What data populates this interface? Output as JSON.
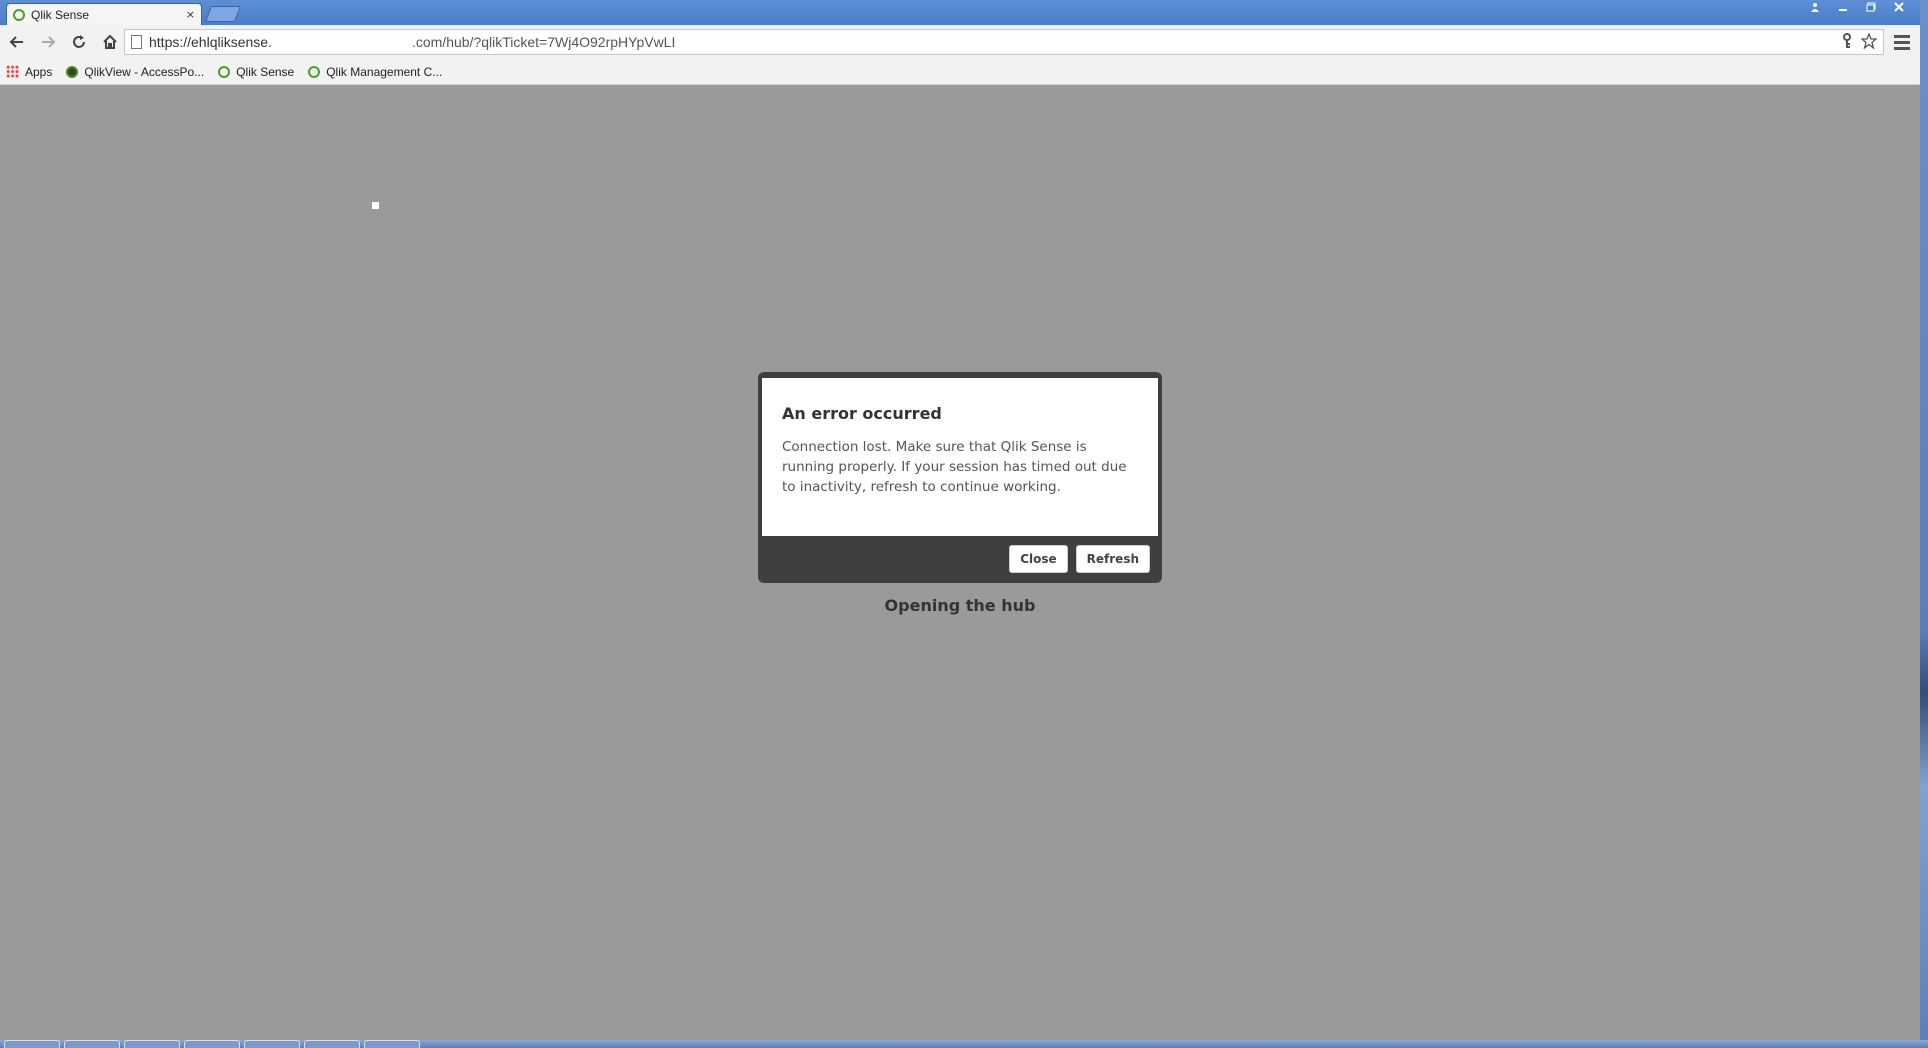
{
  "browser": {
    "tab_title": "Qlik Sense",
    "tab_close": "×",
    "url_part1": "https://ehlqliksense.",
    "url_part2": ".com/hub/?qlikTicket=7Wj4O92rpHYpVwLI",
    "window_controls": [
      "person-icon",
      "minimize-icon",
      "restore-icon",
      "close-icon"
    ]
  },
  "bookmarks": [
    {
      "label": "Apps",
      "icon": "apps-grid-icon"
    },
    {
      "label": "QlikView - AccessPo...",
      "icon": "qlikview-icon"
    },
    {
      "label": "Qlik Sense",
      "icon": "qlik-icon"
    },
    {
      "label": "Qlik Management C...",
      "icon": "qlik-icon"
    }
  ],
  "dialog": {
    "title": "An error occurred",
    "message": "Connection lost. Make sure that Qlik Sense is running properly. If your session has timed out due to inactivity, refresh to continue working.",
    "close_label": "Close",
    "refresh_label": "Refresh"
  },
  "status_text": "Opening the hub",
  "colors": {
    "page_background": "#9a9a9a",
    "dialog_frame": "#3f3f3f",
    "titlebar": "#4a7cc8",
    "qlik_green": "#4aa02c"
  }
}
